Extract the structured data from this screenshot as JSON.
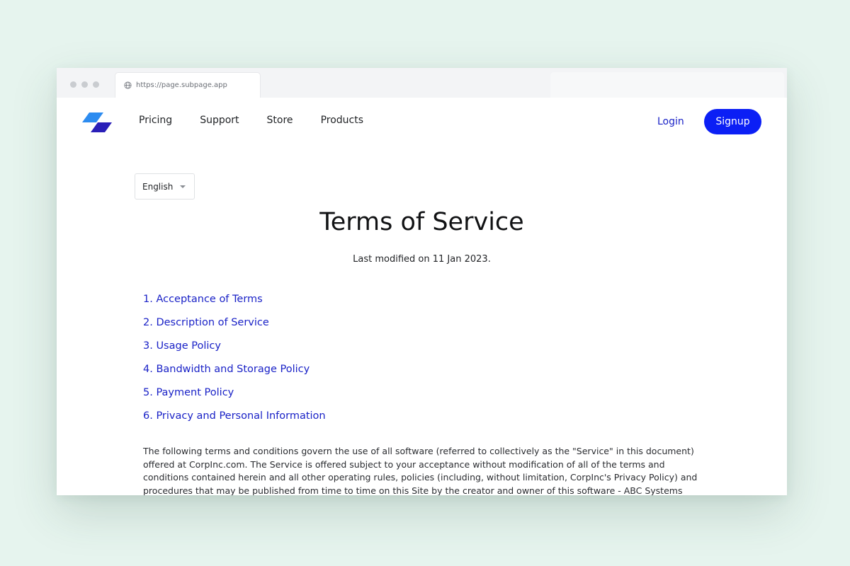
{
  "browser": {
    "url": "https://page.subpage.app"
  },
  "nav": {
    "logo": "brand-logo",
    "links": [
      "Pricing",
      "Support",
      "Store",
      "Products"
    ],
    "login_label": "Login",
    "signup_label": "Signup"
  },
  "language": {
    "selected": "English"
  },
  "page": {
    "title": "Terms of Service",
    "last_modified": "Last modified on 11 Jan 2023."
  },
  "toc": [
    "1. Acceptance of Terms",
    "2. Description of Service",
    "3. Usage Policy",
    "4. Bandwidth and Storage Policy",
    "5. Payment Policy",
    "6. Privacy and Personal Information"
  ],
  "intro": "The following terms and conditions govern the use of all software (referred to collectively as the \"Service\" in this document) offered at CorpInc.com. The Service is offered subject to your acceptance without modification of all of the terms and conditions contained herein and all other operating rules, policies (including, without limitation, CorpInc's Privacy Policy) and procedures that may be published from time to time on this Site by the creator and owner of this software - ABC Systems Systems Pvt Limited.",
  "colors": {
    "accent": "#0b1ff5",
    "link": "#1a22c7",
    "background": "#e6f4ee"
  }
}
